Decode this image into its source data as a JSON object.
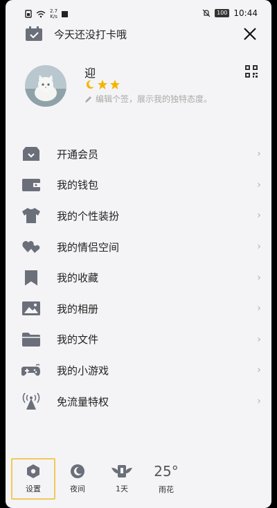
{
  "status_bar": {
    "speed_value": "2.7",
    "speed_unit": "K/s",
    "battery": "100",
    "time": "10:44"
  },
  "checkin": {
    "text": "今天还没打卡哦"
  },
  "profile": {
    "username": "迎",
    "signature_placeholder": "编辑个签，展示我的独特态度。"
  },
  "menu": {
    "items": [
      {
        "label": "开通会员",
        "icon": "vip-shop-icon"
      },
      {
        "label": "我的钱包",
        "icon": "wallet-icon"
      },
      {
        "label": "我的个性装扮",
        "icon": "tshirt-icon"
      },
      {
        "label": "我的情侣空间",
        "icon": "couple-hearts-icon"
      },
      {
        "label": "我的收藏",
        "icon": "bookmark-icon"
      },
      {
        "label": "我的相册",
        "icon": "photo-icon"
      },
      {
        "label": "我的文件",
        "icon": "folder-icon"
      },
      {
        "label": "我的小游戏",
        "icon": "gamepad-icon"
      },
      {
        "label": "免流量特权",
        "icon": "signal-tower-icon"
      }
    ]
  },
  "bottom_bar": {
    "settings": "设置",
    "night": "夜间",
    "days": "1天",
    "weather_temp": "25°",
    "weather_desc": "雨花"
  },
  "colors": {
    "icon_gray": "#6b6f7a",
    "active_border": "#f0c95a",
    "star_gold": "#f5b400"
  }
}
